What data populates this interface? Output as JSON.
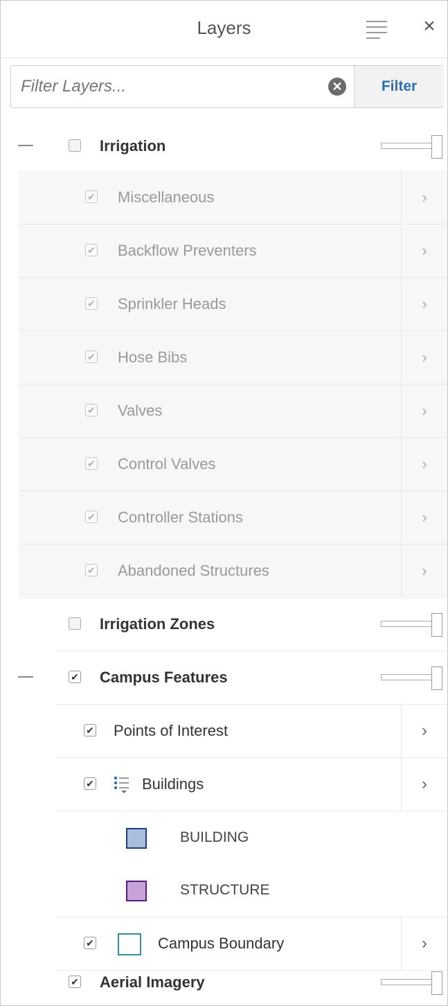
{
  "panel": {
    "title": "Layers",
    "menu_icon": "hamburger-menu-icon",
    "close_icon": "close-icon",
    "close_glyph": "×"
  },
  "filter": {
    "placeholder": "Filter Layers...",
    "value": "",
    "clear_icon": "clear-circle-icon",
    "clear_glyph": "✕",
    "button_label": "Filter",
    "button_color": "#2a6eb5"
  },
  "groups": {
    "irrigation": {
      "label": "Irrigation",
      "checked": false,
      "expanded": true
    },
    "irrigation_zones": {
      "label": "Irrigation Zones",
      "checked": false
    },
    "campus_features": {
      "label": "Campus Features",
      "checked": true,
      "expanded": true
    },
    "aerial_imagery": {
      "label": "Aerial Imagery",
      "checked": true
    }
  },
  "irrigation_layers": [
    {
      "label": "Miscellaneous",
      "checked": true
    },
    {
      "label": "Backflow Preventers",
      "checked": true
    },
    {
      "label": "Sprinkler Heads",
      "checked": true
    },
    {
      "label": "Hose Bibs",
      "checked": true
    },
    {
      "label": "Valves",
      "checked": true
    },
    {
      "label": "Control Valves",
      "checked": true
    },
    {
      "label": "Controller Stations",
      "checked": true
    },
    {
      "label": "Abandoned Structures",
      "checked": true
    }
  ],
  "campus_layers": {
    "points_of_interest": {
      "label": "Points of Interest",
      "checked": true
    },
    "buildings": {
      "label": "Buildings",
      "checked": true,
      "icon": "legend-list-icon"
    },
    "campus_boundary": {
      "label": "Campus Boundary",
      "checked": true,
      "swatch_color": "#2e8fa5"
    }
  },
  "legend": [
    {
      "label": "BUILDING",
      "fill": "#a9bedb",
      "stroke": "#1f3f7a"
    },
    {
      "label": "STRUCTURE",
      "fill": "#c7a3d9",
      "stroke": "#5b1d7a"
    }
  ],
  "glyphs": {
    "check": "✔",
    "chevron": "›"
  }
}
